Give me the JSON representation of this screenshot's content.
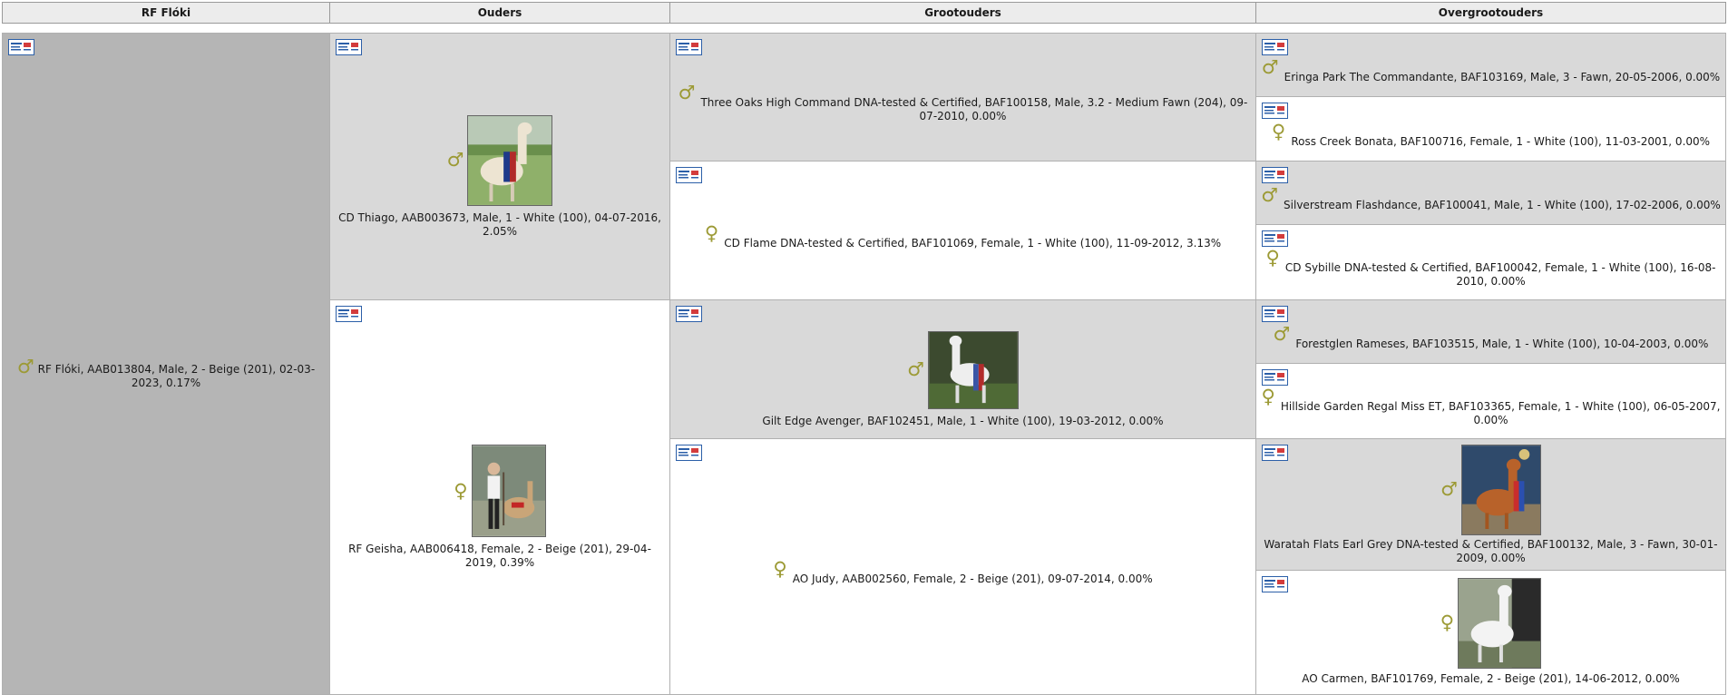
{
  "headers": {
    "self": "RF Flóki",
    "parents": "Ouders",
    "grandparents": "Grootouders",
    "great_grandparents": "Overgrootouders"
  },
  "symbols": {
    "male": "♂",
    "female": "♀"
  },
  "colors": {
    "symbol": "#9c9a35",
    "shade": "#d9d9d9",
    "self_shade": "#b5b5b5",
    "card_blue": "#2c5fa8",
    "card_red": "#d33c3c"
  },
  "self": {
    "text": "RF Flóki, AAB013804, Male, 2 - Beige (201), 02-03-2023, 0.17%"
  },
  "parents": [
    {
      "text": "CD Thiago, AAB003673, Male, 1 - White (100), 04-07-2016, 2.05%"
    },
    {
      "text": "RF Geisha, AAB006418, Female, 2 - Beige (201), 29-04-2019, 0.39%"
    }
  ],
  "grandparents": [
    {
      "text": "Three Oaks High Command DNA-tested & Certified, BAF100158, Male, 3.2 - Medium Fawn (204), 09-07-2010, 0.00%"
    },
    {
      "text": "CD Flame DNA-tested & Certified, BAF101069, Female, 1 - White (100), 11-09-2012, 3.13%"
    },
    {
      "text": "Gilt Edge Avenger, BAF102451, Male, 1 - White (100), 19-03-2012, 0.00%"
    },
    {
      "text": "AO Judy, AAB002560, Female, 2 - Beige (201), 09-07-2014, 0.00%"
    }
  ],
  "great_grandparents": [
    {
      "text": "Eringa Park The Commandante, BAF103169, Male, 3 - Fawn, 20-05-2006, 0.00%"
    },
    {
      "text": "Ross Creek Bonata, BAF100716, Female, 1 - White (100), 11-03-2001, 0.00%"
    },
    {
      "text": "Silverstream Flashdance, BAF100041, Male, 1 - White (100), 17-02-2006, 0.00%"
    },
    {
      "text": "CD Sybille DNA-tested & Certified, BAF100042, Female, 1 - White (100), 16-08-2010, 0.00%"
    },
    {
      "text": "Forestglen Rameses, BAF103515, Male, 1 - White (100), 10-04-2003, 0.00%"
    },
    {
      "text": "Hillside Garden Regal Miss ET, BAF103365, Female, 1 - White (100), 06-05-2007, 0.00%"
    },
    {
      "text": "Waratah Flats Earl Grey DNA-tested & Certified, BAF100132, Male, 3 - Fawn, 30-01-2009, 0.00%"
    },
    {
      "text": "AO Carmen, BAF101769, Female, 2 - Beige (201), 14-06-2012, 0.00%"
    }
  ]
}
